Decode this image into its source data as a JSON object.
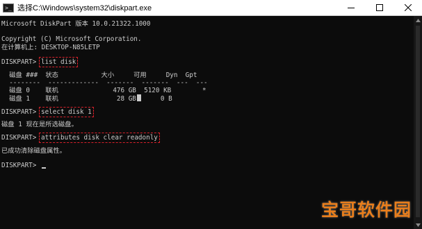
{
  "window": {
    "title": "选择C:\\Windows\\system32\\diskpart.exe",
    "icon": "console-window-icon"
  },
  "console": {
    "lines": [
      "Microsoft DiskPart 版本 10.0.21322.1000",
      "Copyright (C) Microsoft Corporation.",
      "在计算机上: DESKTOP-N85LETP"
    ],
    "prompt": "DISKPART> ",
    "cmd1": "list disk",
    "table_header": "  磁盘 ###  状态           大小     可用     Dyn  Gpt",
    "table_rule": "  --------  -------------  -------  -------  ---  ---",
    "row0": "  磁盘 0    联机              476 GB  5120 KB        *",
    "row1_pre": "  磁盘 1    联机               28 GB",
    "row1_post": "     0 B",
    "cmd2": "select disk 1",
    "resp2": "磁盘 1 现在是所选磁盘。",
    "cmd3": "attributes disk clear readonly",
    "resp3": "已成功清除磁盘属性。"
  },
  "watermark": "宝哥软件园",
  "colors": {
    "console_bg": "#0c0c0c",
    "console_text": "#cccccc",
    "highlight_box": "#d9202a",
    "watermark": "#e87e1c"
  }
}
